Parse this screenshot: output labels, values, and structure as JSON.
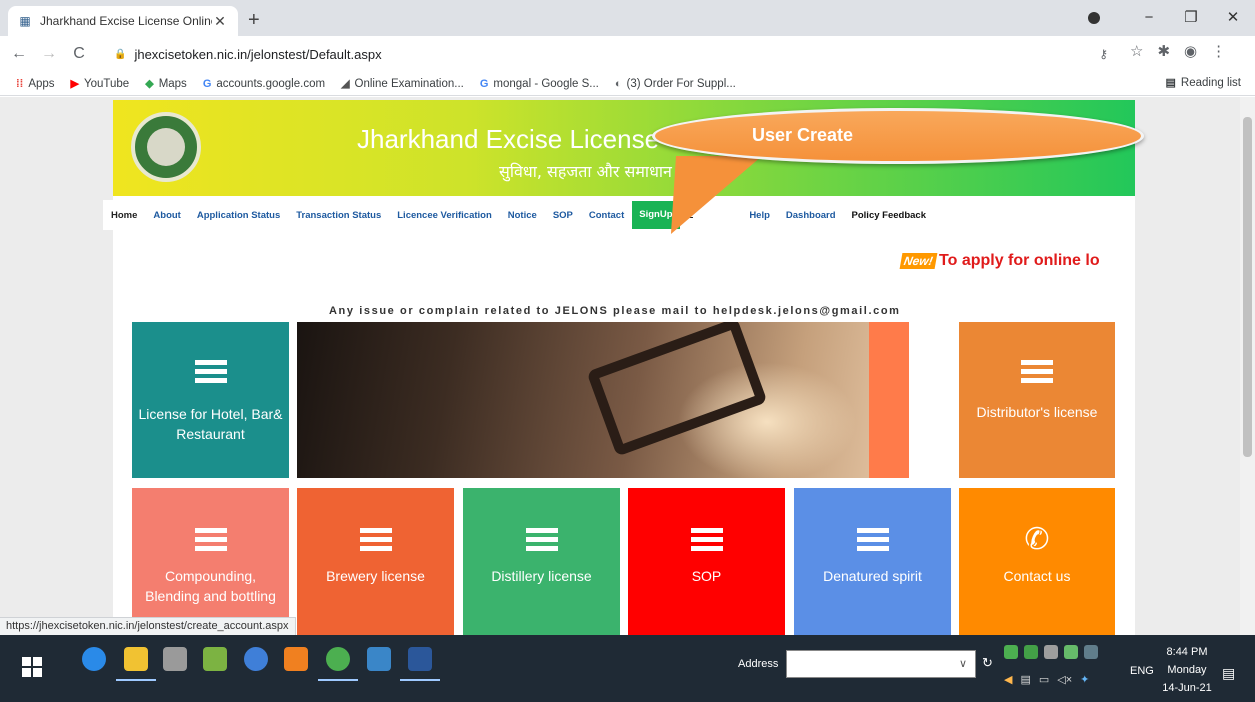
{
  "browser": {
    "tab_title": "Jharkhand Excise License Online",
    "tab_close": "✕",
    "new_tab": "+",
    "window_controls": {
      "minimize": "−",
      "maximize": "❐",
      "close": "✕"
    },
    "url": "jhexcisetoken.nic.in/jelonstest/Default.aspx",
    "bookmarks": [
      {
        "label": "Apps",
        "icon": "apps-grid-icon",
        "color": "#e8453c"
      },
      {
        "label": "YouTube",
        "icon": "youtube-icon",
        "color": "#ff0000"
      },
      {
        "label": "Maps",
        "icon": "maps-icon",
        "color": "#34a853"
      },
      {
        "label": "accounts.google.com",
        "icon": "google-icon",
        "color": "#4285f4"
      },
      {
        "label": "Online Examination...",
        "icon": "exam-icon",
        "color": "#555555"
      },
      {
        "label": "mongal - Google S...",
        "icon": "google-icon",
        "color": "#4285f4"
      },
      {
        "label": "(3) Order For Suppl...",
        "icon": "globe-icon",
        "color": "#5f6368"
      }
    ],
    "reading_list": "Reading list",
    "status_url": "https://jhexcisetoken.nic.in/jelonstest/create_account.aspx"
  },
  "site": {
    "title": "Jharkhand Excise License",
    "tagline": "सुविधा, सहजता और समाधान ...हमारा",
    "menu": [
      "Home",
      "About",
      "Application Status",
      "Transaction Status",
      "Licencee Verification",
      "Notice",
      "SOP",
      "Contact",
      "SignUp",
      "L",
      "Help",
      "Dashboard",
      "Policy Feedback"
    ],
    "new_badge": "New!",
    "marquee": "To apply for online lo",
    "mail_note": "Any issue or complain related to JELONS please mail to helpdesk.jelons@gmail.com",
    "tiles_row1": [
      {
        "label": "License for Hotel, Bar& Restaurant",
        "color": "#1b8f8c"
      },
      {
        "label": "Distributor's license",
        "color": "#eb8734"
      }
    ],
    "tiles_row2": [
      {
        "label": "Compounding, Blending and bottling",
        "color": "#f47e6f"
      },
      {
        "label": "Brewery license",
        "color": "#ef6333"
      },
      {
        "label": "Distillery license",
        "color": "#3bb36d"
      },
      {
        "label": "SOP",
        "color": "#ff0000"
      },
      {
        "label": "Denatured spirit",
        "color": "#5b8fe6"
      },
      {
        "label": "Contact us",
        "color": "#ff8a00"
      }
    ]
  },
  "callout": {
    "text": "User Create"
  },
  "taskbar": {
    "address_label": "Address",
    "dropdown": "∨",
    "refresh": "↻",
    "language": "ENG",
    "time": "8:44 PM",
    "day": "Monday",
    "date": "14-Jun-21"
  }
}
